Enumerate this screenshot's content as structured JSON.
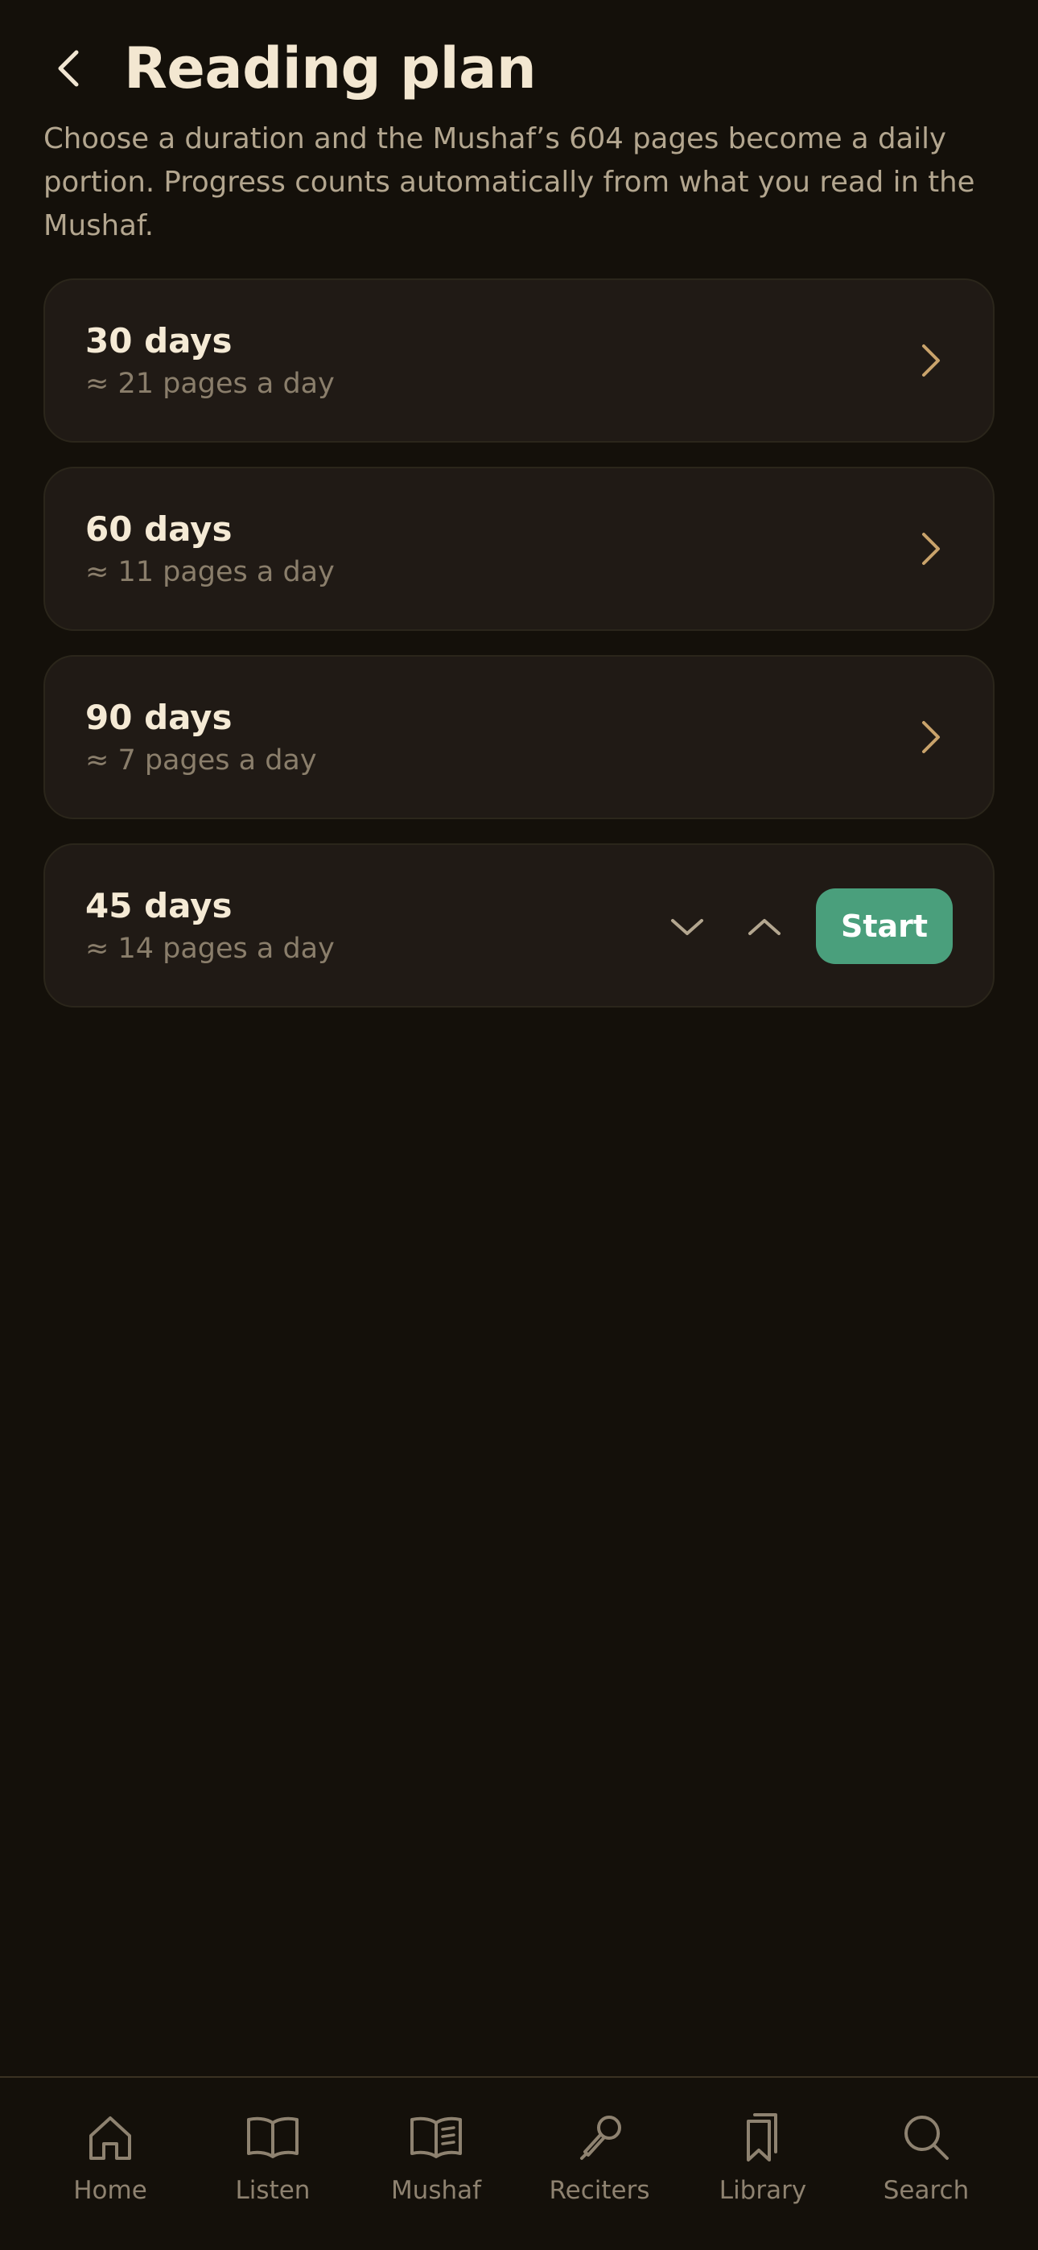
{
  "header": {
    "title": "Reading plan",
    "back_icon": "chevron-left-icon",
    "description": "Choose a duration and the Mushaf’s 604 pages become a daily portion. Progress counts automatically from what you read in the Mushaf."
  },
  "plans": [
    {
      "title": "30 days",
      "subtitle": "≈ 21 pages a day",
      "icon": "chevron-right-icon"
    },
    {
      "title": "60 days",
      "subtitle": "≈ 11 pages a day",
      "icon": "chevron-right-icon"
    },
    {
      "title": "90 days",
      "subtitle": "≈ 7 pages a day",
      "icon": "chevron-right-icon"
    }
  ],
  "custom_plan": {
    "title": "45 days",
    "subtitle": "≈ 14 pages a day",
    "decrease_icon": "chevron-down-icon",
    "increase_icon": "chevron-up-icon",
    "start_label": "Start"
  },
  "nav": {
    "items": [
      {
        "label": "Home",
        "icon": "home-icon"
      },
      {
        "label": "Listen",
        "icon": "open-book-icon"
      },
      {
        "label": "Mushaf",
        "icon": "book-text-icon"
      },
      {
        "label": "Reciters",
        "icon": "microphone-icon"
      },
      {
        "label": "Library",
        "icon": "bookmarks-icon"
      },
      {
        "label": "Search",
        "icon": "search-icon"
      }
    ]
  },
  "colors": {
    "background": "#14100a",
    "card": "#201a15",
    "accent": "#c9a36b",
    "start_button": "#4a9f7c",
    "title_text": "#f3e7d1",
    "muted_text": "#8a7e6b"
  }
}
